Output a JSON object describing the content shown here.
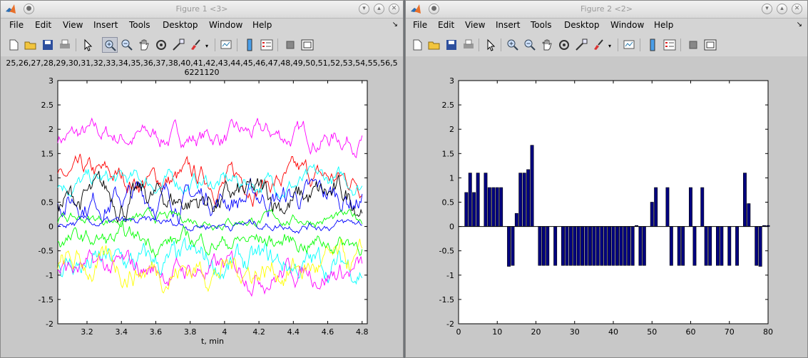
{
  "menu_labels": [
    "File",
    "Edit",
    "View",
    "Insert",
    "Tools",
    "Desktop",
    "Window",
    "Help"
  ],
  "window1": {
    "title": "Figure 1 <3>",
    "axes_title_line1": "25,26,27,28,29,30,31,32,33,34,35,36,37,38,40,41,42,43,44,45,46,47,48,49,50,51,52,53,54,55,56,5",
    "axes_title_line2": "6221120",
    "chart": {
      "type": "line",
      "xlabel": "t, min",
      "xlim": [
        3.03,
        4.83
      ],
      "ylim": [
        -2,
        3
      ],
      "xticks": [
        "3.2",
        "3.4",
        "3.6",
        "3.8",
        "4",
        "4.2",
        "4.4",
        "4.6",
        "4.8"
      ],
      "yticks": [
        "3",
        "2.5",
        "2",
        "1.5",
        "1",
        "0.5",
        "0",
        "-0.5",
        "-1",
        "-1.5",
        "-2"
      ],
      "series": [
        {
          "color": "#ff00ff",
          "mean": 1.85,
          "amp": 0.22
        },
        {
          "color": "#ff0000",
          "mean": 0.95,
          "amp": 0.25
        },
        {
          "color": "#00ffff",
          "mean": 0.9,
          "amp": 0.2
        },
        {
          "color": "#0000ff",
          "mean": 0.6,
          "amp": 0.28
        },
        {
          "color": "#000000",
          "mean": 0.55,
          "amp": 0.3
        },
        {
          "color": "#00ff00",
          "mean": 0.15,
          "amp": 0.12
        },
        {
          "color": "#00ffff",
          "mean": -0.8,
          "amp": 0.3
        },
        {
          "color": "#ff00ff",
          "mean": -0.9,
          "amp": 0.25
        },
        {
          "color": "#ffff00",
          "mean": -0.85,
          "amp": 0.3
        },
        {
          "color": "#0000ff",
          "mean": 0.05,
          "amp": 0.1
        },
        {
          "color": "#00ff00",
          "mean": -0.3,
          "amp": 0.2
        }
      ]
    }
  },
  "window2": {
    "title": "Figure 2 <2>",
    "chart": {
      "type": "bar",
      "xlim": [
        0,
        80
      ],
      "ylim": [
        -2,
        3
      ],
      "xticks": [
        "0",
        "10",
        "20",
        "30",
        "40",
        "50",
        "60",
        "70",
        "80"
      ],
      "yticks": [
        "3",
        "2.5",
        "2",
        "1.5",
        "1",
        "0.5",
        "0",
        "-0.5",
        "-1",
        "-1.5",
        "-2"
      ],
      "bar_color": "#000080",
      "values": [
        0,
        0.7,
        1.1,
        0.7,
        1.1,
        0,
        1.1,
        0.8,
        0.8,
        0.8,
        0.8,
        0,
        -0.82,
        -0.8,
        0.27,
        1.1,
        1.1,
        1.17,
        1.67,
        0,
        -0.8,
        -0.8,
        -0.8,
        0,
        -0.8,
        0,
        -0.8,
        -0.8,
        -0.8,
        -0.8,
        -0.8,
        -0.8,
        -0.8,
        -0.8,
        -0.8,
        -0.8,
        -0.8,
        -0.8,
        -0.8,
        -0.8,
        -0.8,
        -0.8,
        -0.8,
        -0.8,
        -0.8,
        0.02,
        -0.8,
        -0.8,
        0,
        0.5,
        0.8,
        0,
        0,
        0.8,
        -0.8,
        0,
        -0.8,
        -0.8,
        0,
        0.8,
        -0.8,
        0,
        0.8,
        -0.8,
        -0.8,
        0,
        -0.8,
        -0.8,
        0,
        -0.8,
        0,
        -0.8,
        0,
        1.1,
        0.47,
        0,
        -0.8,
        -0.82,
        0.02,
        0.02
      ]
    }
  }
}
